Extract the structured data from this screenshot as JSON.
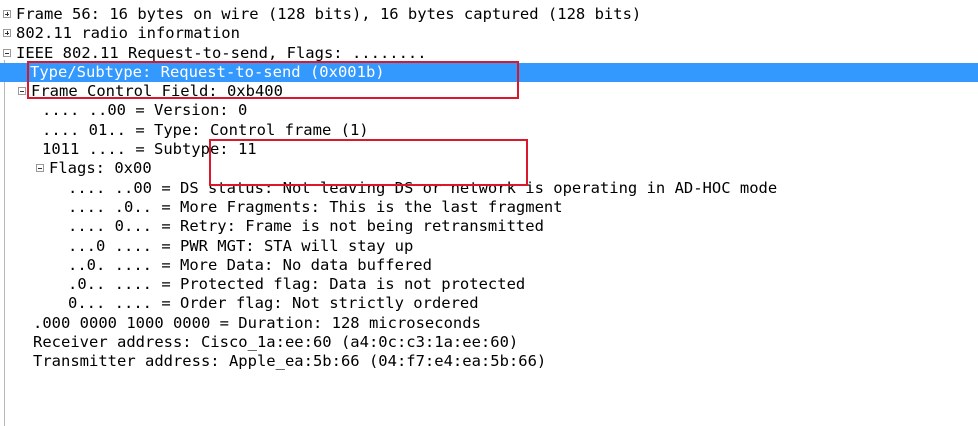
{
  "packet_tree": {
    "frame": "Frame 56: 16 bytes on wire (128 bits), 16 bytes captured (128 bits)",
    "radio": "802.11 radio information",
    "ieee": "IEEE 802.11 Request-to-send, Flags: ........",
    "type_subtype": "Type/Subtype: Request-to-send (0x001b)",
    "fcf": "Frame Control Field: 0xb400",
    "version": ".... ..00 = Version: 0",
    "type_bits": ".... 01.. = ",
    "type_val": "Type: Control frame (1)",
    "subtype_bits": "1011 .... = ",
    "subtype_val": "Subtype: 11",
    "flags": "Flags: 0x00",
    "ds_status": ".... ..00 = DS status: Not leaving DS or network is operating in AD-HOC mode",
    "more_frag": ".... .0.. = More Fragments: This is the last fragment",
    "retry": ".... 0... = Retry: Frame is not being retransmitted",
    "pwr_mgt": "...0 .... = PWR MGT: STA will stay up",
    "more_data": "..0. .... = More Data: No data buffered",
    "protected": ".0.. .... = Protected flag: Data is not protected",
    "order": "0... .... = Order flag: Not strictly ordered",
    "duration": ".000 0000 1000 0000 = Duration: 128 microseconds",
    "receiver": "Receiver address: Cisco_1a:ee:60 (a4:0c:c3:1a:ee:60)",
    "transmitter": "Transmitter address: Apple_ea:5b:66 (04:f7:e4:ea:5b:66)"
  },
  "colors": {
    "selection": "#3399ff",
    "highlight_box": "#d9192b"
  }
}
